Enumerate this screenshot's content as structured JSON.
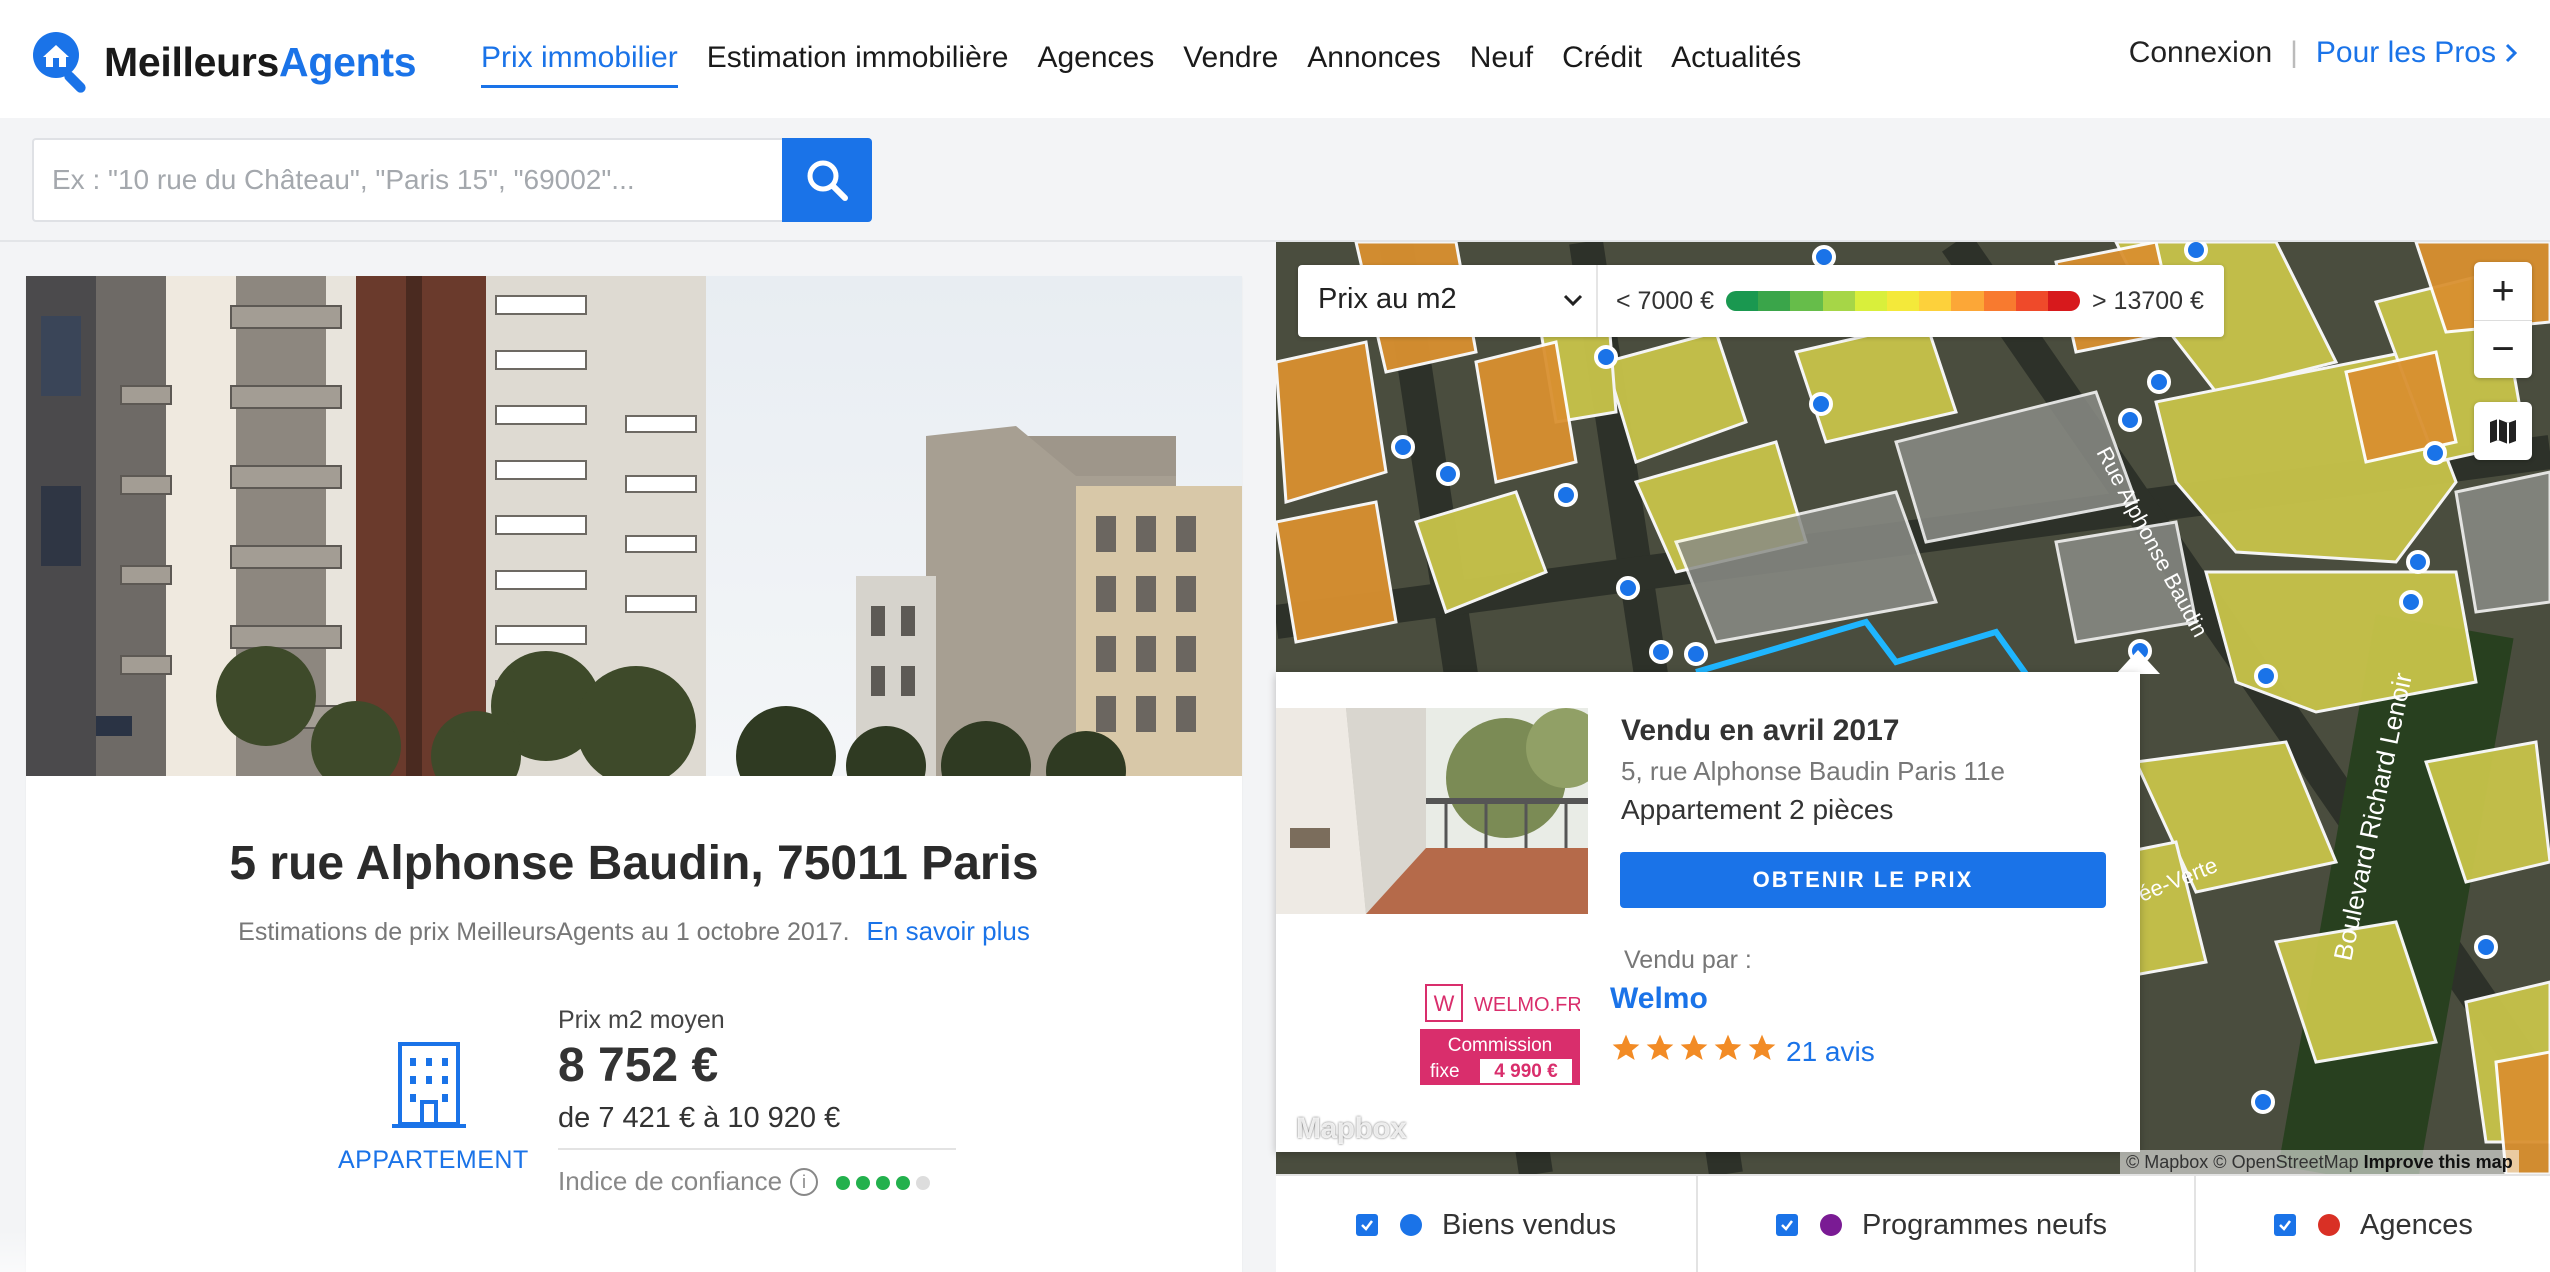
{
  "header": {
    "logo": {
      "part1": "Meilleurs",
      "part2": "Agents"
    },
    "nav": [
      {
        "label": "Prix immobilier",
        "active": true
      },
      {
        "label": "Estimation immobilière"
      },
      {
        "label": "Agences"
      },
      {
        "label": "Vendre"
      },
      {
        "label": "Annonces"
      },
      {
        "label": "Neuf"
      },
      {
        "label": "Crédit"
      },
      {
        "label": "Actualités"
      }
    ],
    "login": "Connexion",
    "separator": "|",
    "pros": "Pour les Pros",
    "pros_icon": "chevron-right-icon"
  },
  "search": {
    "placeholder": "Ex : \"10 rue du Château\", \"Paris 15\", \"69002\"...",
    "icon": "search-icon"
  },
  "property": {
    "address": "5 rue Alphonse Baudin, 75011 Paris",
    "estimation_text": "Estimations de prix MeilleursAgents au 1 octobre 2017.",
    "more_link": "En savoir plus",
    "type_label": "APPARTEMENT",
    "price_label": "Prix m2 moyen",
    "price_value": "8 752 €",
    "price_range": "de 7 421 € à 10 920 €",
    "confidence_label": "Indice de confiance",
    "confidence_info_icon": "i",
    "confidence_level": 4,
    "confidence_max": 5
  },
  "map": {
    "select_label": "Prix au m2",
    "legend_min": "< 7000 €",
    "legend_max": "> 13700 €",
    "legend_colors": [
      "#1a9850",
      "#3aa54a",
      "#66bd4a",
      "#a6d647",
      "#d9ef3b",
      "#f4e93a",
      "#fdd13b",
      "#fca737",
      "#f87a2f",
      "#ef4a2a",
      "#d7191c"
    ],
    "zoom_in": "+",
    "zoom_out": "−",
    "layer_icon": "map-icon",
    "street_labels": [
      "Rue Alphonse Baudin",
      "Boulevard Richard Lenoir",
      "ée-Verte"
    ],
    "popup": {
      "title": "Vendu en avril 2017",
      "address": "5, rue Alphonse Baudin Paris 11e",
      "type": "Appartement 2 pièces",
      "cta": "OBTENIR LE PRIX",
      "sold_by": "Vendu par :",
      "agency": "Welmo",
      "agency_logo_text": "WELMO.FR",
      "agency_logo_sub1": "Commission",
      "agency_logo_sub2": "fixe",
      "agency_logo_price": "4 990 €",
      "rating": 5,
      "reviews": "21 avis"
    },
    "mapbox_logo": "Mapbox",
    "attribution": "© Mapbox © OpenStreetMap",
    "improve": "Improve this map"
  },
  "filters": [
    {
      "label": "Biens vendus",
      "color": "#1a73e8",
      "checked": true
    },
    {
      "label": "Programmes neufs",
      "color": "#7a1b94",
      "checked": true
    },
    {
      "label": "Agences",
      "color": "#d93025",
      "checked": true
    }
  ]
}
